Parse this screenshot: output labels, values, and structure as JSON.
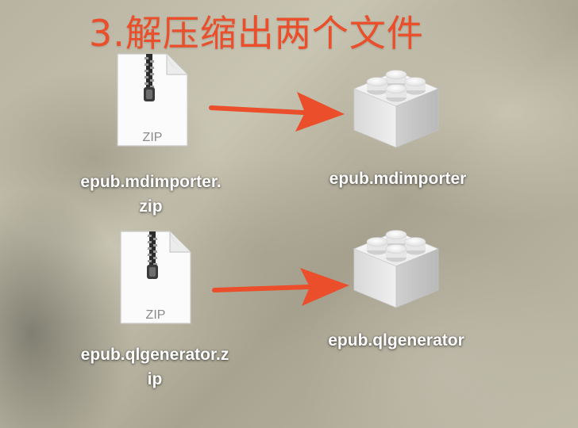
{
  "title": "3.解压缩出两个文件",
  "colors": {
    "accent": "#ea4e2a",
    "label": "#ffffff"
  },
  "rows": [
    {
      "zip": {
        "icon": "zip-file-icon",
        "badge": "ZIP",
        "name_line1": "epub.mdimporter.",
        "name_line2": "zip"
      },
      "result": {
        "icon": "plugin-bundle-icon",
        "name": "epub.mdimporter"
      }
    },
    {
      "zip": {
        "icon": "zip-file-icon",
        "badge": "ZIP",
        "name_line1": "epub.qlgenerator.z",
        "name_line2": "ip"
      },
      "result": {
        "icon": "plugin-bundle-icon",
        "name": "epub.qlgenerator"
      }
    }
  ]
}
